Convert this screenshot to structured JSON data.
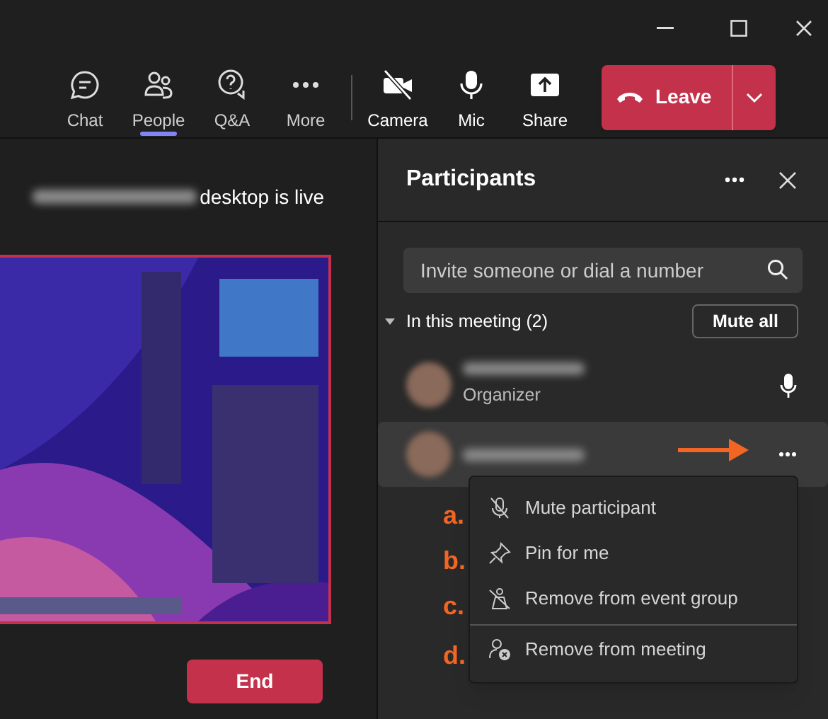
{
  "toolbar": [
    {
      "kind": "chat",
      "label": "Chat",
      "selected": false
    },
    {
      "kind": "people",
      "label": "People",
      "selected": true
    },
    {
      "kind": "qa",
      "label": "Q&A",
      "selected": false
    },
    {
      "kind": "more",
      "label": "More",
      "selected": false
    },
    {
      "kind": "camera",
      "label": "Camera",
      "selected": false
    },
    {
      "kind": "mic",
      "label": "Mic",
      "selected": false
    },
    {
      "kind": "share",
      "label": "Share",
      "selected": false
    }
  ],
  "leave_button": {
    "label": "Leave"
  },
  "stage": {
    "status": "desktop is live",
    "end_button": "End"
  },
  "participants_panel": {
    "title": "Participants",
    "search": {
      "placeholder": "Invite someone or dial a number"
    },
    "section": {
      "label": "In this meeting (2)",
      "expanded": true,
      "mute_all": "Mute all"
    },
    "people": [
      {
        "role": "Organizer",
        "selected": false
      },
      {
        "selected": true
      }
    ],
    "context_menu": [
      {
        "kind": "mute",
        "label": "Mute participant",
        "marker": "a.",
        "divider_before": false
      },
      {
        "kind": "pin",
        "label": "Pin for me",
        "marker": "b.",
        "divider_before": false
      },
      {
        "kind": "remove-group",
        "label": "Remove from event group",
        "marker": "c.",
        "divider_before": false
      },
      {
        "kind": "remove-meeting",
        "label": "Remove from meeting",
        "marker": "d.",
        "divider_before": true
      }
    ]
  }
}
